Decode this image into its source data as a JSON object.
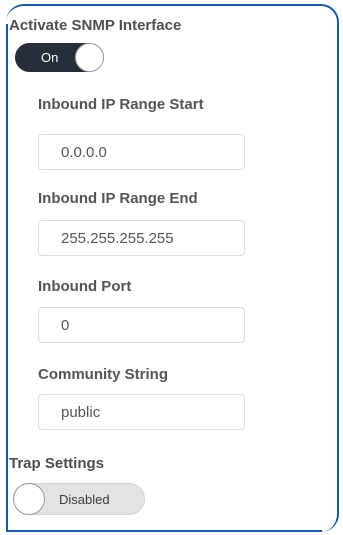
{
  "snmp": {
    "title": "Activate SNMP Interface",
    "toggle_label": "On",
    "enabled": true
  },
  "fields": [
    {
      "label": "Inbound IP Range Start",
      "value": "0.0.0.0"
    },
    {
      "label": "Inbound IP Range End",
      "value": "255.255.255.255"
    },
    {
      "label": "Inbound Port",
      "value": "0"
    },
    {
      "label": "Community String",
      "value": "public"
    }
  ],
  "trap": {
    "title": "Trap Settings",
    "toggle_label": "Disabled",
    "enabled": false
  },
  "colors": {
    "border_accent": "#1a5a9e",
    "toggle_on_bg": "#262e3a",
    "toggle_off_bg": "#e3e3e3"
  }
}
